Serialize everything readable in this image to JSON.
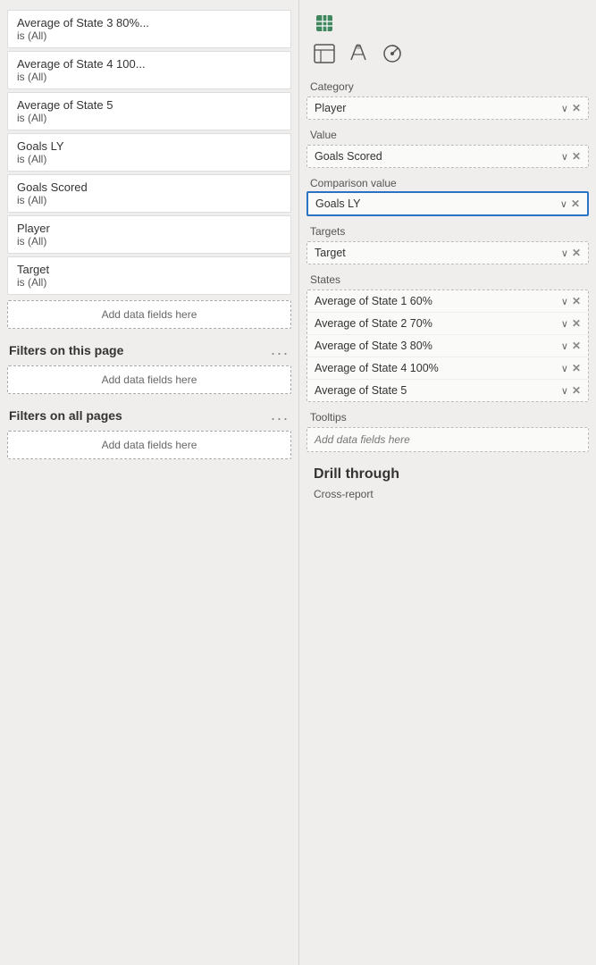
{
  "left_panel": {
    "filters": [
      {
        "name": "Average of State 3 80%...",
        "value": "is (All)"
      },
      {
        "name": "Average of State 4 100...",
        "value": "is (All)"
      },
      {
        "name": "Average of State 5",
        "value": "is (All)"
      },
      {
        "name": "Goals LY",
        "value": "is (All)"
      },
      {
        "name": "Goals Scored",
        "value": "is (All)"
      },
      {
        "name": "Player",
        "value": "is (All)"
      },
      {
        "name": "Target",
        "value": "is (All)"
      }
    ],
    "add_data_label": "Add data fields here",
    "filters_this_page_label": "Filters on this page",
    "filters_all_pages_label": "Filters on all pages",
    "dots": "..."
  },
  "right_panel": {
    "tabs": [
      {
        "icon": "fields-icon",
        "active": true
      },
      {
        "icon": "format-icon",
        "active": false
      },
      {
        "icon": "analytics-icon",
        "active": false
      }
    ],
    "sections": [
      {
        "label": "Category",
        "fields": [
          {
            "name": "Player",
            "has_chevron": true,
            "has_close": true
          }
        ]
      },
      {
        "label": "Value",
        "fields": [
          {
            "name": "Goals Scored",
            "has_chevron": true,
            "has_close": true
          }
        ]
      },
      {
        "label": "Comparison value",
        "is_highlighted": true,
        "fields": [
          {
            "name": "Goals LY",
            "has_chevron": true,
            "has_close": true
          }
        ]
      },
      {
        "label": "Targets",
        "fields": [
          {
            "name": "Target",
            "has_chevron": true,
            "has_close": true
          }
        ]
      },
      {
        "label": "States",
        "fields": [
          {
            "name": "Average of State 1 60%",
            "has_chevron": true,
            "has_close": true
          },
          {
            "name": "Average of State 2 70%",
            "has_chevron": true,
            "has_close": true
          },
          {
            "name": "Average of State 3 80%",
            "has_chevron": true,
            "has_close": true
          },
          {
            "name": "Average of State 4 100%",
            "has_chevron": true,
            "has_close": true
          },
          {
            "name": "Average of State 5",
            "has_chevron": true,
            "has_close": true
          }
        ]
      },
      {
        "label": "Tooltips",
        "add_placeholder": "Add data fields here"
      }
    ],
    "drill_through": {
      "title": "Drill through",
      "sub_label": "Cross-report"
    }
  }
}
